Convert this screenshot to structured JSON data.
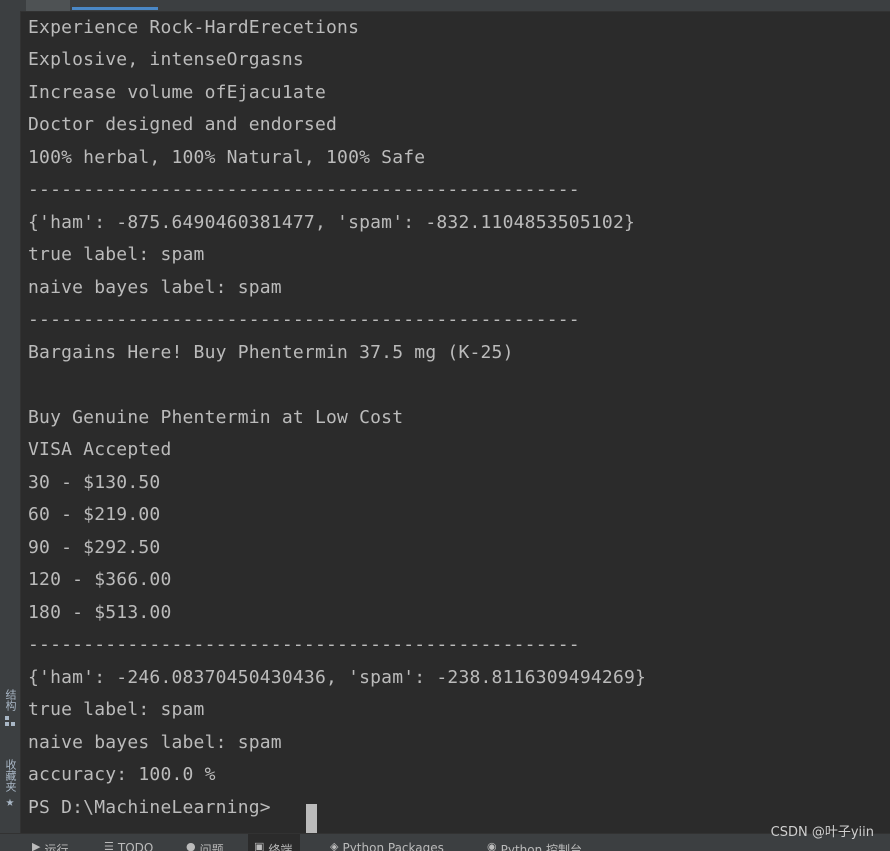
{
  "terminal": {
    "lines": [
      "Experience Rock-HardErecetions",
      "Explosive, intenseOrgasns",
      "Increase volume ofEjacu1ate",
      "Doctor designed and endorsed",
      "100% herbal, 100% Natural, 100% Safe",
      "--------------------------------------------------",
      "{'ham': -875.6490460381477, 'spam': -832.1104853505102}",
      "true label: spam",
      "naive bayes label: spam",
      "--------------------------------------------------",
      "Bargains Here! Buy Phentermin 37.5 mg (K-25)",
      "",
      "Buy Genuine Phentermin at Low Cost",
      "VISA Accepted",
      "30 - $130.50",
      "60 - $219.00",
      "90 - $292.50",
      "120 - $366.00",
      "180 - $513.00",
      "--------------------------------------------------",
      "{'ham': -246.08370450430436, 'spam': -238.8116309494269}",
      "true label: spam",
      "naive bayes label: spam",
      "accuracy: 100.0 %",
      "PS D:\\MachineLearning> "
    ]
  },
  "left_sidebar": {
    "structure_label": "结构",
    "favorites_label": "收藏夹"
  },
  "bottom_tabs": [
    {
      "label": "运行",
      "icon": "play-icon"
    },
    {
      "label": "TODO",
      "icon": "list-icon"
    },
    {
      "label": "问题",
      "icon": "problem-icon"
    },
    {
      "label": "终端",
      "icon": "terminal-icon",
      "active": true
    },
    {
      "label": "Python Packages",
      "icon": "package-icon"
    },
    {
      "label": "Python 控制台",
      "icon": "python-console-icon"
    }
  ],
  "watermark": "CSDN @叶子yiin",
  "colors": {
    "terminal_bg": "#2b2b2b",
    "terminal_fg": "#bbbbbb",
    "chrome_bg": "#3c3f41",
    "accent": "#4a88c7"
  }
}
